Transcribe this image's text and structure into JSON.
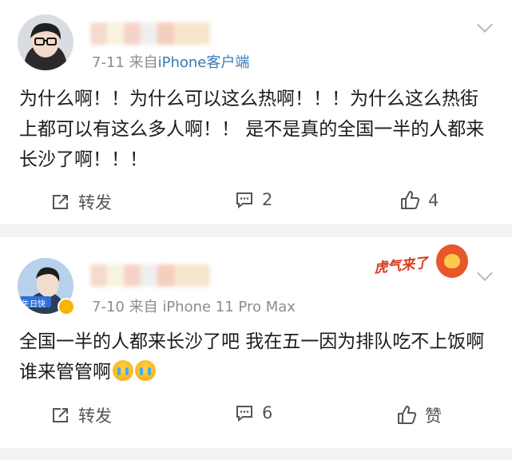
{
  "posts": [
    {
      "date": "7-11",
      "source_prefix": "来自",
      "device": "iPhone客户端",
      "text": "为什么啊！！为什么可以这么热啊！！！为什么这么热街上都可以有这么多人啊！！ 是不是真的全国一半的人都来长沙了啊！！！",
      "actions": {
        "repost": "转发",
        "comments": "2",
        "likes": "4"
      }
    },
    {
      "date": "7-10",
      "source_prefix": "来自",
      "device": "iPhone 11 Pro Max",
      "avatar_badge": "生日快",
      "text": "全国一半的人都来长沙了吧 我在五一因为排队吃不上饭啊 谁来管管啊",
      "sticker_text": "虎气来了",
      "actions": {
        "repost": "转发",
        "comments": "6",
        "likes": "赞"
      }
    }
  ],
  "colors": {
    "link": "#3a7ab6",
    "meta": "#8c8c8c",
    "divider": "#f2f2f2",
    "sticker": "#d93a1e"
  }
}
